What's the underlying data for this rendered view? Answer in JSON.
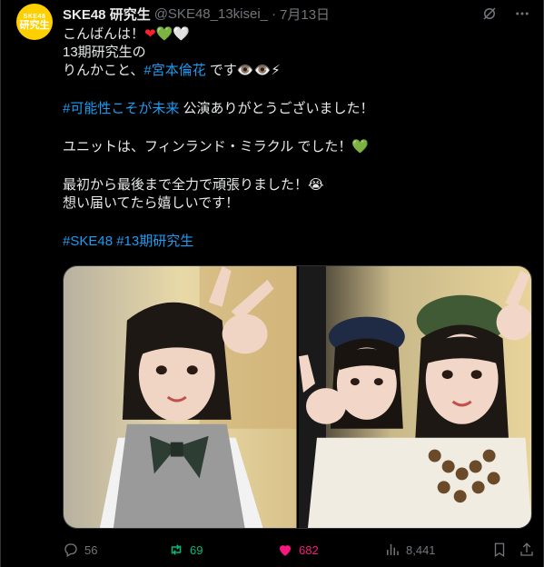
{
  "post": {
    "author_name": "SKE48 研究生",
    "author_handle": "@SKE48_13kisei_",
    "separator": "·",
    "date": "7月13日",
    "avatar": {
      "line1": "SKE48",
      "line2": "研究生"
    },
    "lines": {
      "l1_text": "こんばんは！",
      "l1_h1": "❤",
      "l1_h2": "💚",
      "l1_h3": "🤍",
      "l2": "13期研究生の",
      "l3_pre": "りんかこと、",
      "l3_tag": "#宮本倫花",
      "l3_post": " です👁️👁️⚡",
      "l4_tag": "#可能性こそが未来",
      "l4_post": " 公演ありがとうございました！",
      "l5_text": "ユニットは、フィンランド・ミラクル でした！",
      "l5_heart": "💚",
      "l6": "最初から最後まで全力で頑張りました！😭",
      "l7": "想い届いてたら嬉しいです！",
      "l8_tag1": "#SKE48",
      "l8_tag2": "#13期研究生"
    }
  },
  "actions": {
    "replies": "56",
    "reposts": "69",
    "likes": "682",
    "views": "8,441"
  },
  "colors": {
    "accent_blue": "#1d9bf0",
    "repost_green": "#00ba7c",
    "like_pink": "#f91880",
    "avatar_yellow": "#ffd000"
  },
  "icons": [
    "grok-icon",
    "more-icon",
    "reply-icon",
    "repost-icon",
    "like-heart-icon",
    "views-icon",
    "bookmark-icon",
    "share-icon"
  ]
}
